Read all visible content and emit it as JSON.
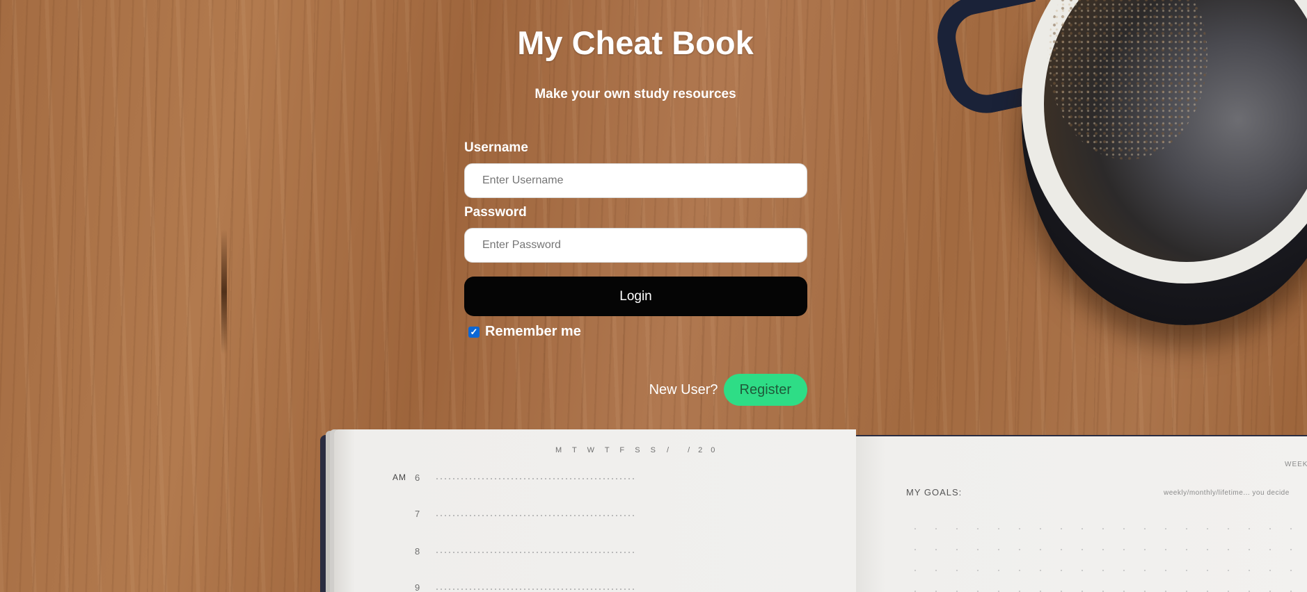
{
  "app": {
    "title": "My Cheat Book",
    "subtitle": "Make your own study resources"
  },
  "form": {
    "username_label": "Username",
    "username_placeholder": "Enter Username",
    "username_value": "",
    "password_label": "Password",
    "password_placeholder": "Enter Password",
    "password_value": "",
    "login_label": "Login",
    "remember_label": "Remember me",
    "remember_checked": true,
    "new_user_text": "New User?",
    "register_label": "Register"
  },
  "background_notebook": {
    "weekdays": "M T W T F S S",
    "date_field": "/ /20",
    "am_label": "AM",
    "hours": [
      "6",
      "7",
      "8",
      "9"
    ],
    "goals_heading": "MY GOALS:",
    "goals_hint": "weekly/monthly/lifetime... you decide",
    "week_label": "WEEK"
  },
  "colors": {
    "login_button": "#050505",
    "register_button": "#2edd86",
    "checkbox": "#0b67d6",
    "text": "#ffffff"
  }
}
